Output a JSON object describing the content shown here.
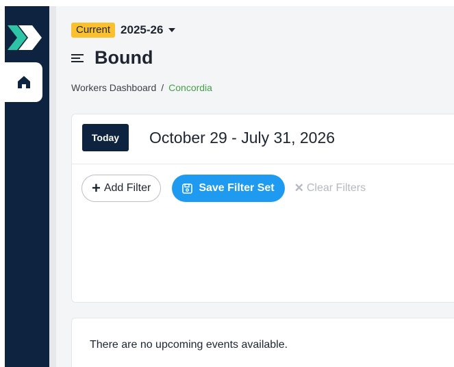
{
  "header": {
    "season_badge": "Current",
    "season_value": "2025-26",
    "title": "Bound"
  },
  "breadcrumb": {
    "items": [
      "Workers Dashboard",
      "Concordia"
    ],
    "separator": "/"
  },
  "date_bar": {
    "today_label": "Today",
    "range": "October 29 - July 31, 2026"
  },
  "filters": {
    "add_label": "Add Filter",
    "save_label": "Save Filter Set",
    "clear_label": "Clear Filters"
  },
  "events": {
    "empty_message": "There are no upcoming events available."
  },
  "icons": {
    "logo": "bound-logo-icon",
    "home": "home-icon",
    "menu": "menu-icon",
    "caret": "caret-down-icon",
    "plus": "plus-icon",
    "save": "floppy-disk-icon",
    "clear": "x-icon"
  },
  "colors": {
    "nav": "#0d2340",
    "badge": "#fbc02d",
    "primary": "#1e9bf0",
    "breadcrumb_active": "#43a047"
  }
}
